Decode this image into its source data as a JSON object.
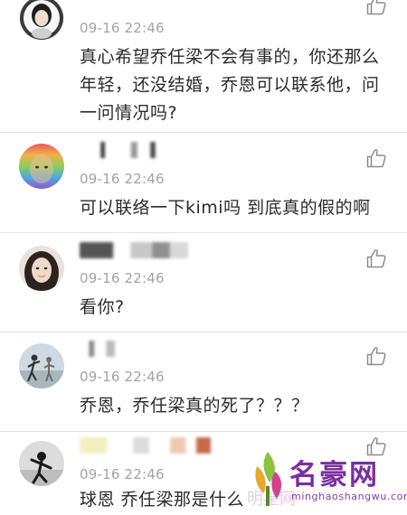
{
  "comments": [
    {
      "time": "09-16 22:46",
      "text": "真心希望乔任梁不会有事的，你还那么年轻，还没结婚，乔恩可以联系他，问一问情况吗?"
    },
    {
      "time": "09-16 22:46",
      "text": "可以联络一下kimi吗 到底真的假的啊"
    },
    {
      "time": "09-16 22:46",
      "text": "看你?"
    },
    {
      "time": "09-16 22:46",
      "text": "乔恩，乔任梁真的死了？？？"
    },
    {
      "time": "09-16 22:46",
      "text": "球恩 乔任梁那是什么"
    }
  ],
  "icons": {
    "like": "thumbs-up-icon"
  },
  "watermark": {
    "logo_text": "名豪网",
    "url": "minghaoshangwu.com",
    "faint_text": "明星网"
  },
  "colors": {
    "time": "#a3a3a3",
    "divider": "#e3e3e3",
    "watermark": "#7a2ea0"
  }
}
